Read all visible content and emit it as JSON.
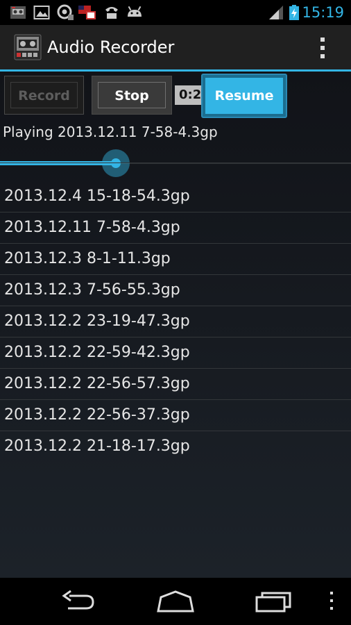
{
  "status_bar": {
    "time": "15:19",
    "left_icons": [
      "recorder-notification-icon",
      "gallery-icon",
      "voicemail-icon",
      "flag-app-icon",
      "phone-icon",
      "android-icon"
    ],
    "right_icons": [
      "signal-icon",
      "battery-charging-icon"
    ]
  },
  "action_bar": {
    "title": "Audio Recorder",
    "app_icon": "cassette-recorder-icon",
    "menu_icon": "overflow-menu-icon"
  },
  "controls": {
    "record_label": "Record",
    "stop_label": "Stop",
    "timer": "0:2",
    "resume_label": "Resume"
  },
  "player": {
    "now_playing": "Playing 2013.12.11 7-58-4.3gp",
    "progress_fraction": 0.33
  },
  "recordings": [
    "2013.12.4 15-18-54.3gp",
    "2013.12.11 7-58-4.3gp",
    "2013.12.3 8-1-11.3gp",
    "2013.12.3 7-56-55.3gp",
    "2013.12.2 23-19-47.3gp",
    "2013.12.2 22-59-42.3gp",
    "2013.12.2 22-56-57.3gp",
    "2013.12.2 22-56-37.3gp",
    "2013.12.2 21-18-17.3gp"
  ],
  "nav_bar": {
    "icons": [
      "back-icon",
      "home-icon",
      "recent-apps-icon",
      "menu-icon"
    ]
  },
  "colors": {
    "accent": "#33b5e5",
    "action_bar": "#202020",
    "background": "#111318"
  }
}
